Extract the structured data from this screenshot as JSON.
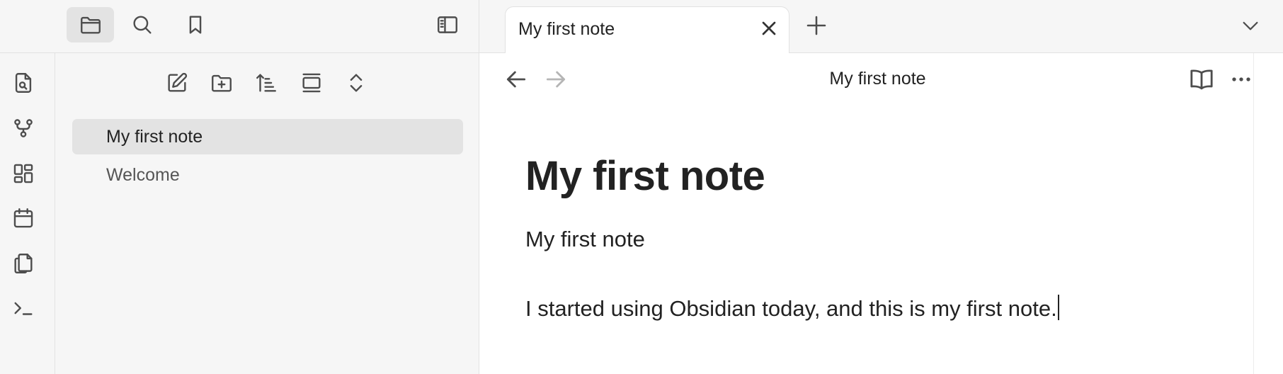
{
  "sidebar_tabs": [
    {
      "name": "files",
      "icon": "folder-icon",
      "active": true
    },
    {
      "name": "search",
      "icon": "search-icon",
      "active": false
    },
    {
      "name": "bookmarks",
      "icon": "bookmark-icon",
      "active": false
    }
  ],
  "ribbon": [
    {
      "icon": "quick-switcher-icon"
    },
    {
      "icon": "graph-view-icon"
    },
    {
      "icon": "canvas-icon"
    },
    {
      "icon": "daily-note-calendar-icon"
    },
    {
      "icon": "templates-copy-icon"
    },
    {
      "icon": "command-palette-icon"
    }
  ],
  "explorer": {
    "actions": [
      "new-note-icon",
      "new-folder-icon",
      "sort-icon",
      "collapse-view-icon",
      "expand-collapse-icon"
    ],
    "files": [
      {
        "label": "My first note",
        "active": true
      },
      {
        "label": "Welcome",
        "active": false
      }
    ]
  },
  "tabs": {
    "active_title": "My first note"
  },
  "view": {
    "title": "My first note",
    "heading": "My first note",
    "body_line_1": "My first note",
    "body_line_2": "I started using Obsidian today, and this is my first note."
  },
  "colors": {
    "sidebar_bg": "#f6f6f6",
    "active_bg": "#e3e3e3",
    "border": "#e2e2e2",
    "text": "#222222",
    "icon": "#4d4d4d"
  }
}
